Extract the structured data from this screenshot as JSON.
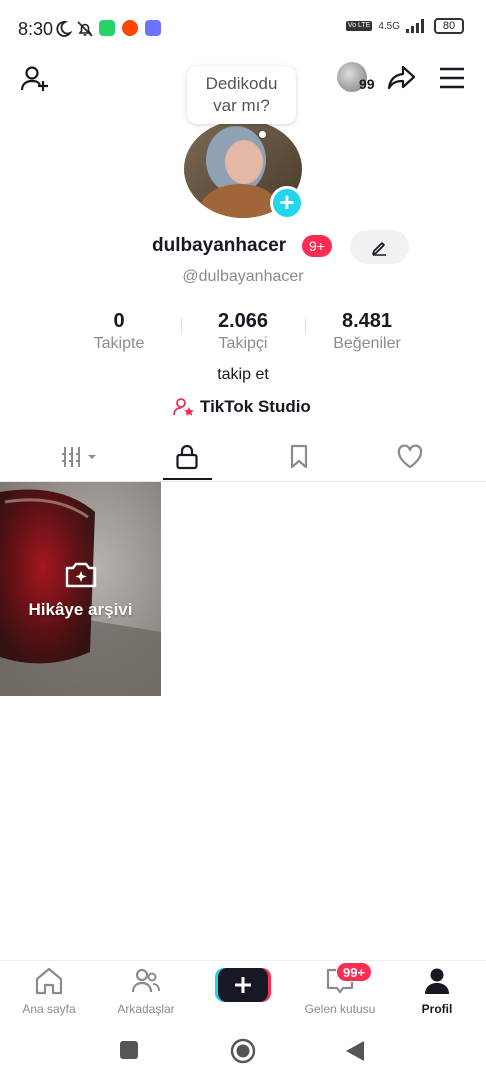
{
  "status_bar": {
    "time": "8:30",
    "network": "4.5G",
    "battery": "80",
    "volte": "Vo LTE"
  },
  "bubble": {
    "text_line1": "Dedikodu",
    "text_line2": "var mı?"
  },
  "header": {
    "friends_badge": "99"
  },
  "profile": {
    "username": "dulbayanhacer",
    "notification_badge": "9+",
    "handle": "@dulbayanhacer",
    "stats": [
      {
        "value": "0",
        "label": "Takipte"
      },
      {
        "value": "2.066",
        "label": "Takipçi"
      },
      {
        "value": "8.481",
        "label": "Beğeniler"
      }
    ],
    "bio": "takip et",
    "studio_link": "TikTok Studio"
  },
  "tabs": {
    "items": [
      "videos-grid",
      "private",
      "bookmarks",
      "liked"
    ],
    "active": "private"
  },
  "content": {
    "story_archive_label": "Hikâye arşivi"
  },
  "bottom_nav": {
    "items": [
      {
        "label": "Ana sayfa",
        "icon": "home-icon"
      },
      {
        "label": "Arkadaşlar",
        "icon": "friends-icon"
      },
      {
        "label": "",
        "icon": "create-icon"
      },
      {
        "label": "Gelen kutusu",
        "icon": "inbox-icon"
      },
      {
        "label": "Profil",
        "icon": "profile-icon"
      }
    ],
    "inbox_badge": "99+"
  },
  "colors": {
    "accent": "#fe2c55",
    "cyan": "#20d5ec",
    "text": "#161823",
    "muted": "#8a8b91"
  }
}
